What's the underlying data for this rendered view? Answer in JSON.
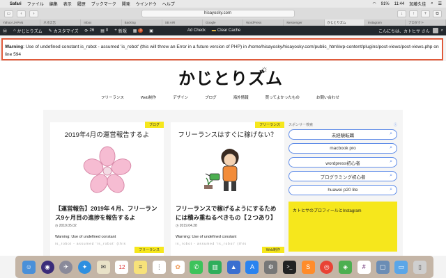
{
  "menubar": {
    "apple": "",
    "app": "Safari",
    "items": [
      "ファイル",
      "編集",
      "表示",
      "履歴",
      "ブックマーク",
      "開発",
      "ウインドウ",
      "ヘルプ"
    ],
    "battery": "91%",
    "time": "11:44",
    "user": "加藤久佳"
  },
  "toolbar": {
    "url": "hisayosky.com"
  },
  "tabs": [
    "Yahoo! JAPAN",
    "ネオ広告",
    "Inbox",
    "Backlog",
    "SB AIR",
    "Google",
    "WordPress",
    "Messenger",
    "かじとりズム",
    "Instagram",
    "プロダクト"
  ],
  "adminbar": {
    "site_name": "かじとりズム",
    "customize": "カスタマイズ",
    "updates_count": "26",
    "comments_count": "0",
    "new_label": "新規",
    "notif_count": "3",
    "ad_check": "Ad Check",
    "clear_cache": "Clear Cache",
    "greeting": "こんにちは、カトヒサ さん"
  },
  "warning": {
    "label": "Warning",
    "text": ": Use of undefined constant is_robot - assumed 'is_robot' (this will throw an Error in a future version of PHP) in /home/hisayosky/hisayosky.com/public_html/wp-content/plugins/post-views/post-views.php on line 594"
  },
  "site": {
    "logo": "かじとりズム",
    "nav": [
      "フリーランス",
      "Web制作",
      "デザイン",
      "ブログ",
      "海外情報",
      "買ってよかったもの",
      "お問い合わせ"
    ]
  },
  "cards": [
    {
      "category": "ブログ",
      "image_title": "2019年4月の運営報告するよ",
      "title": "【運営報告】2019年４月、フリーランス9ヶ月目の進捗を報告するよ",
      "date": "2019.05.02",
      "warning": "Warning: Use of undefined constant",
      "warning2": "is_robot - assumed 'is_robot' (this"
    },
    {
      "category": "フリーランス",
      "image_title": "フリーランスはすぐに稼げない？",
      "title": "フリーランスで稼げるようにするためには積み重ねるべきもの【２つあり】",
      "date": "2019.04.28",
      "warning": "Warning: Use of undefined constant",
      "warning2": "is_robot - assumed 'is_robot' (this"
    }
  ],
  "stubs": [
    "フリーランス",
    "Web制作"
  ],
  "sidebar": {
    "label": "スポンサー検索",
    "info": "ⓘ",
    "searches": [
      "未経験転職",
      "macbook pro",
      "wordpress初心者",
      "プログラミング初心者",
      "huawei p20 lite"
    ],
    "profile": "カトヒサのプロフィールとInstagram"
  },
  "dock": [
    "finder",
    "siri",
    "launchpad",
    "safari",
    "mail",
    "calendar",
    "notes",
    "reminders",
    "photos",
    "messages",
    "numbers",
    "keynote",
    "app-store",
    "system-prefs",
    "terminal",
    "sublime",
    "chrome",
    "vpn",
    "slack",
    "preview",
    "folder",
    "trash"
  ],
  "colors": {
    "accent": "#5c8ae8",
    "category_bg": "#f6e71c",
    "adminbar_bg": "#23282d",
    "warning_border": "#e05a3a"
  }
}
